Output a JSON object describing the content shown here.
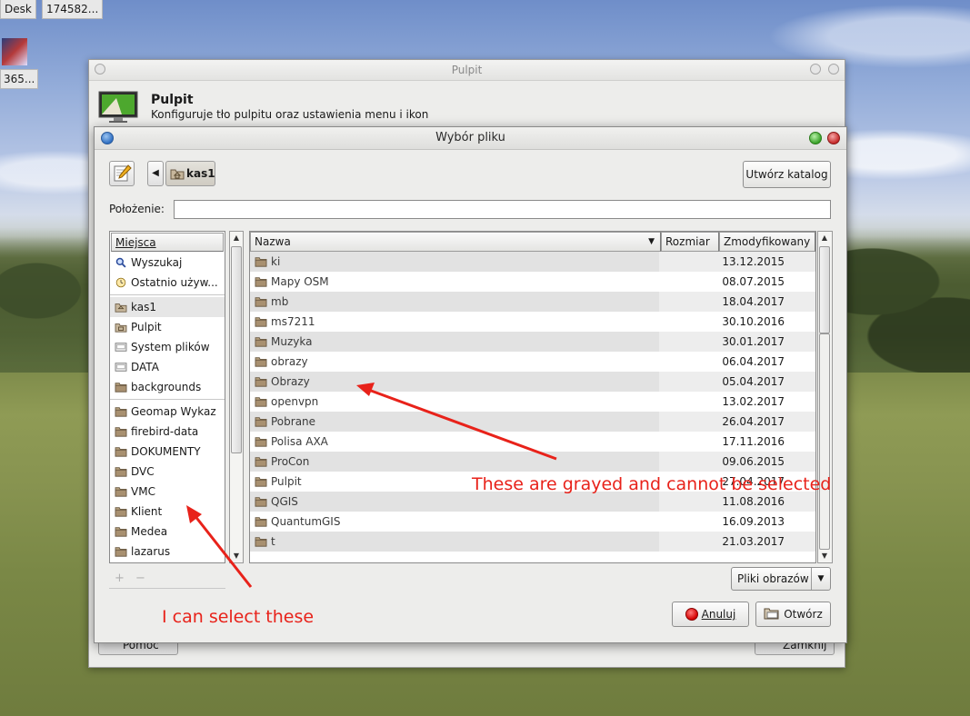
{
  "taskbar": {
    "items": [
      "Desk",
      "174582..."
    ]
  },
  "desktop_icon_label": "365...",
  "bg_window": {
    "title": "Pulpit",
    "heading": "Pulpit",
    "subheading": "Konfiguruje tło pulpitu oraz ustawienia menu i ikon",
    "help_button": "Pomoc",
    "close_button": "Zamknij"
  },
  "dialog": {
    "title": "Wybór pliku",
    "path_current": "kas1",
    "create_folder_button": "Utwórz katalog",
    "location_label": "Położenie:",
    "location_value": "",
    "places": {
      "header": "Miejsca",
      "items": [
        {
          "label": "Wyszukaj",
          "icon": "search-icon"
        },
        {
          "label": "Ostatnio używ...",
          "icon": "clock-icon"
        },
        {
          "label": "kas1",
          "icon": "home-folder-icon",
          "selected": true
        },
        {
          "label": "Pulpit",
          "icon": "desktop-folder-icon"
        },
        {
          "label": "System plików",
          "icon": "drive-icon"
        },
        {
          "label": "DATA",
          "icon": "drive-icon"
        },
        {
          "label": "backgrounds",
          "icon": "folder-icon"
        },
        {
          "label": "Geomap Wykaz",
          "icon": "folder-icon"
        },
        {
          "label": "firebird-data",
          "icon": "folder-icon"
        },
        {
          "label": "DOKUMENTY",
          "icon": "folder-icon"
        },
        {
          "label": "DVC",
          "icon": "folder-icon"
        },
        {
          "label": "VMC",
          "icon": "folder-icon"
        },
        {
          "label": "Klient",
          "icon": "folder-icon"
        },
        {
          "label": "Medea",
          "icon": "folder-icon"
        },
        {
          "label": "lazarus",
          "icon": "folder-icon"
        }
      ],
      "add": "+",
      "remove": "−"
    },
    "files": {
      "columns": [
        "Nazwa",
        "Rozmiar",
        "Zmodyfikowany"
      ],
      "rows": [
        {
          "name": "ki",
          "size": "",
          "modified": "13.12.2015"
        },
        {
          "name": "Mapy OSM",
          "size": "",
          "modified": "08.07.2015"
        },
        {
          "name": "mb",
          "size": "",
          "modified": "18.04.2017"
        },
        {
          "name": "ms7211",
          "size": "",
          "modified": "30.10.2016"
        },
        {
          "name": "Muzyka",
          "size": "",
          "modified": "30.01.2017"
        },
        {
          "name": "obrazy",
          "size": "",
          "modified": "06.04.2017"
        },
        {
          "name": "Obrazy",
          "size": "",
          "modified": "05.04.2017"
        },
        {
          "name": "openvpn",
          "size": "",
          "modified": "13.02.2017"
        },
        {
          "name": "Pobrane",
          "size": "",
          "modified": "26.04.2017"
        },
        {
          "name": "Polisa AXA",
          "size": "",
          "modified": "17.11.2016"
        },
        {
          "name": "ProCon",
          "size": "",
          "modified": "09.06.2015"
        },
        {
          "name": "Pulpit",
          "size": "",
          "modified": "27.04.2017"
        },
        {
          "name": "QGIS",
          "size": "",
          "modified": "11.08.2016"
        },
        {
          "name": "QuantumGIS",
          "size": "",
          "modified": "16.09.2013"
        },
        {
          "name": "t",
          "size": "",
          "modified": "21.03.2017"
        }
      ]
    },
    "filter": "Pliki obrazów",
    "cancel_button": "Anuluj",
    "open_button": "Otwórz"
  },
  "annotations": {
    "grayed": "These are grayed and cannot be selected",
    "selectable": "I can select these"
  },
  "colors": {
    "annotation": "#e8221a",
    "selection": "#e6e6e6"
  }
}
